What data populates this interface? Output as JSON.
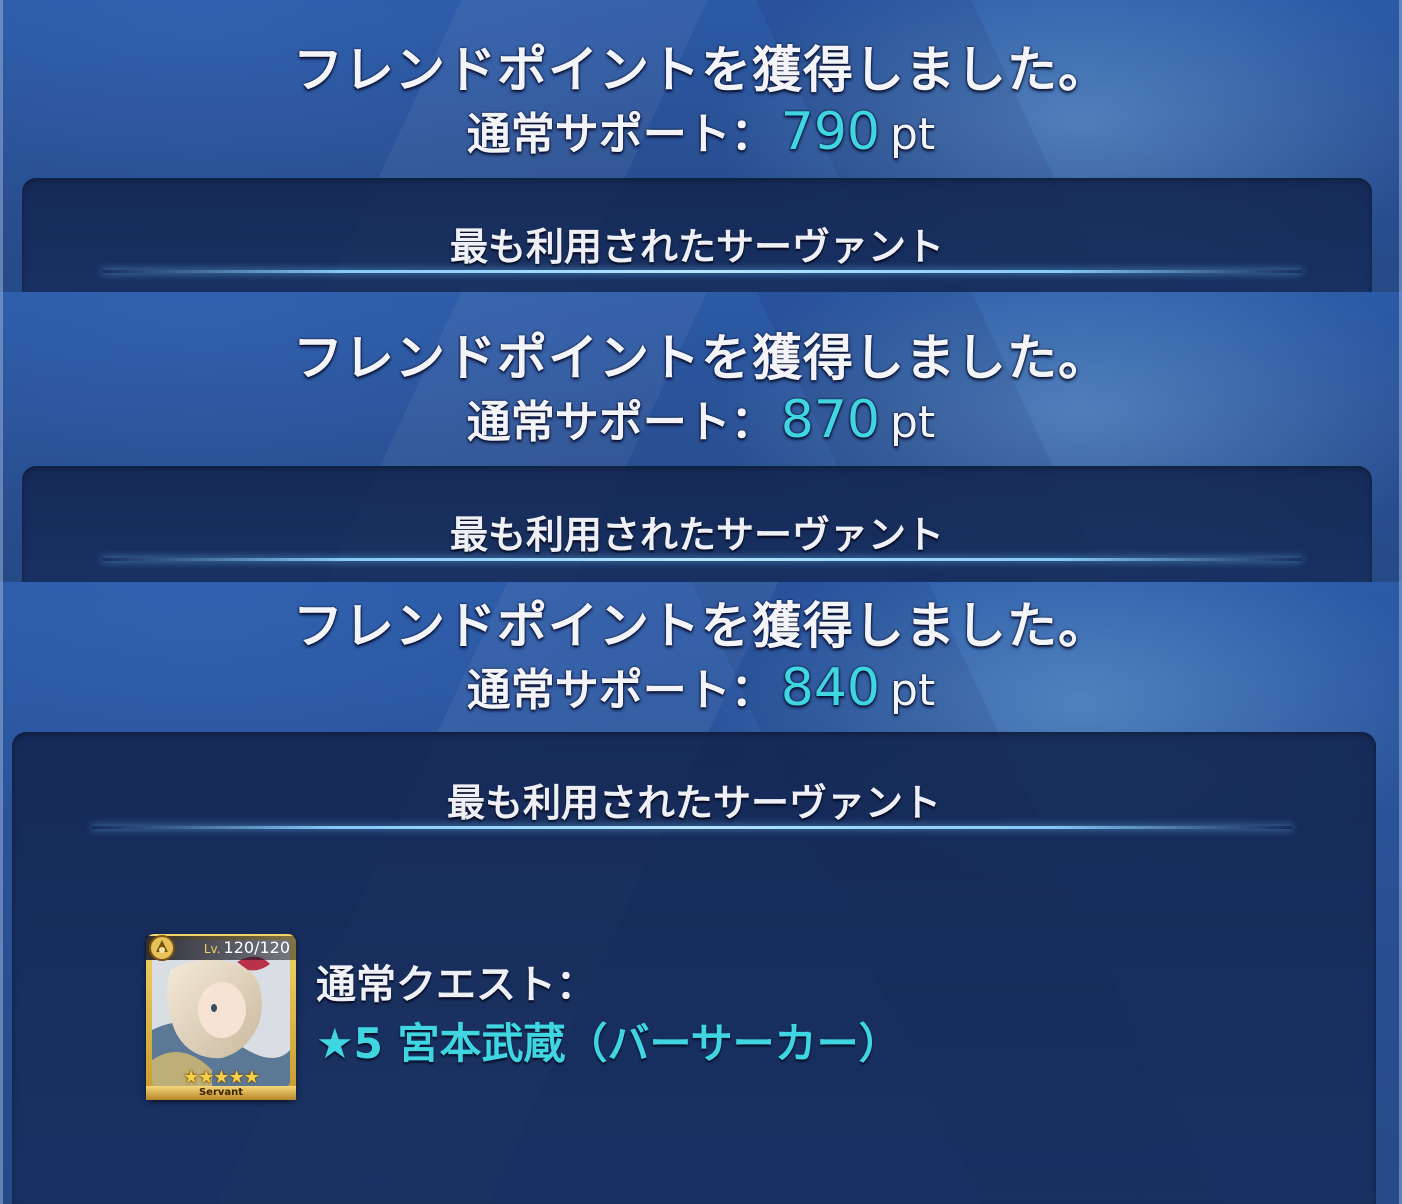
{
  "panels": [
    {
      "title": "フレンドポイントを獲得しました。",
      "support_label": "通常サポート：",
      "points_value": "790",
      "points_unit": "pt",
      "section_title": "最も利用されたサーヴァント"
    },
    {
      "title": "フレンドポイントを獲得しました。",
      "support_label": "通常サポート：",
      "points_value": "870",
      "points_unit": "pt",
      "section_title": "最も利用されたサーヴァント"
    },
    {
      "title": "フレンドポイントを獲得しました。",
      "support_label": "通常サポート：",
      "points_value": "840",
      "points_unit": "pt",
      "section_title": "最も利用されたサーヴァント",
      "quest_label": "通常クエスト：",
      "servant": {
        "name": "★5 宮本武蔵（バーサーカー）",
        "level": "120/120",
        "level_prefix": "Lv.",
        "rarity_stars": "★★★★★",
        "card_footer": "Servant",
        "class_icon": "berserker-class-icon"
      }
    }
  ],
  "colors": {
    "accent_cyan": "#3fd6e2",
    "text_white": "#f2f4f8",
    "panel_blue": "#2a5196"
  }
}
